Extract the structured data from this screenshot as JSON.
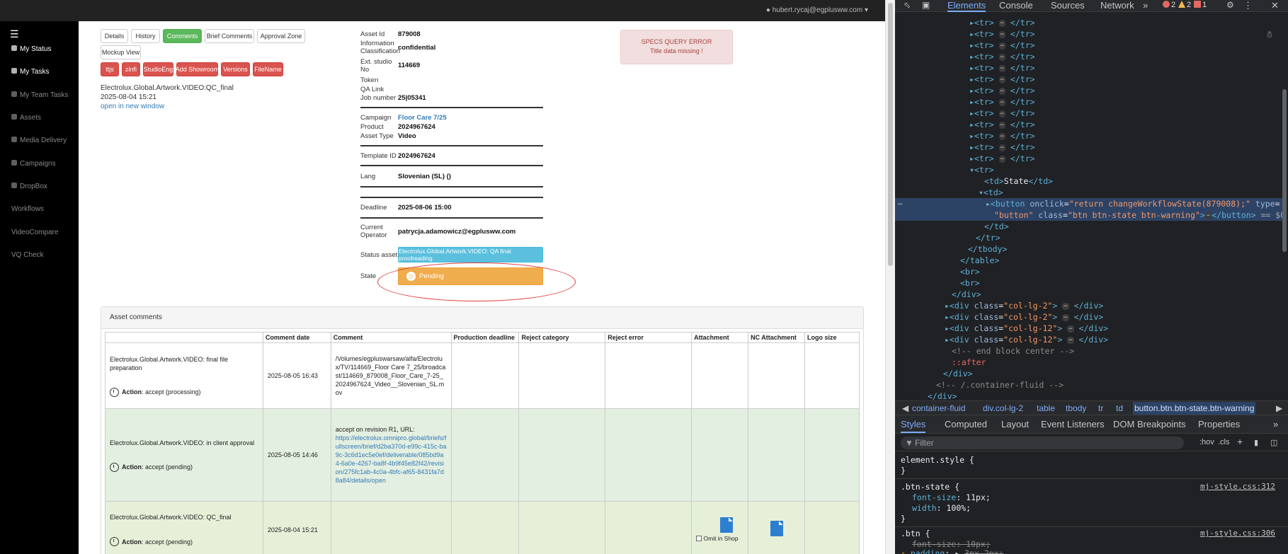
{
  "app": {
    "user": "hubert.rycaj@egplusww.com",
    "sidebar": [
      {
        "label": "My Status",
        "active": true
      },
      {
        "label": "My Tasks",
        "active": true
      },
      {
        "label": "My Team Tasks",
        "active": false
      },
      {
        "label": "Assets",
        "active": false
      },
      {
        "label": "Media Delivery",
        "active": false
      },
      {
        "label": "Campaigns",
        "active": false
      },
      {
        "label": "DropBox",
        "active": false
      },
      {
        "label": "Workflows",
        "active": false
      },
      {
        "label": "VideoCompare",
        "active": false
      },
      {
        "label": "VQ Check",
        "active": false
      }
    ],
    "tabs": [
      "Details",
      "History",
      "Comments",
      "Brief Comments",
      "Approval Zone",
      "Mockup View"
    ],
    "actions": [
      "ttjs",
      "zinfi",
      "StudioEng",
      "Add Showroom",
      "Versions",
      "FileName"
    ],
    "asset_title": "Electrolux.Global.Artwork.VIDEO:QC_final",
    "asset_date": "2025-08-04 15:21",
    "open_new_window": "open in new window",
    "info": {
      "asset_id_label": "Asset Id",
      "asset_id": "879008",
      "info_class_label": "Information Classification",
      "info_class": "confidential",
      "ext_studio_label": "Ext. studio No",
      "ext_studio": "114669",
      "token_label": "Token",
      "qa_link_label": "QA Link",
      "job_label": "Job number",
      "job": "25|05341",
      "campaign_label": "Campaign",
      "campaign": "Floor Care 7/25",
      "product_label": "Product",
      "product": "2024967624",
      "asset_type_label": "Asset Type",
      "asset_type": "Video",
      "template_label": "Template ID",
      "template": "2024967624",
      "lang_label": "Lang",
      "lang": "Slovenian (SL) ()",
      "deadline_label": "Deadline",
      "deadline": "2025-08-06 15:00",
      "operator_label": "Current Operator",
      "operator": "patrycja.adamowicz@egplusww.com",
      "status_label": "Status asset",
      "status": "Electrolux.Global.Artwork.VIDEO: QA final proofreading",
      "state_label": "State",
      "state": "Pending"
    },
    "error": {
      "line1": "SPECS QUERY ERROR",
      "line2": "Title data missing !"
    },
    "comments": {
      "heading": "Asset comments",
      "columns": [
        "",
        "Comment date",
        "Comment",
        "Production deadline",
        "Reject category",
        "Reject error",
        "Attachment",
        "NC Attachment",
        "Logo size"
      ],
      "rows": [
        {
          "workflow": "Electrolux.Global.Artwork.VIDEO: final file preparation",
          "action_label": "Action",
          "action": ": accept (processing)",
          "date": "2025-08-05 16:43",
          "comment": "/Volumes/egpluswarsaw/alfa/Electrolux/TV/114669_Floor Care 7_25/broadcast/114669_879008_Floor_Care_7-25_2024967624_Video__Slovenian_SL.mov",
          "comment_link": ""
        },
        {
          "workflow": "Electrolux.Global.Artwork.VIDEO: in client approval",
          "action_label": "Action",
          "action": ": accept (pending)",
          "date": "2025-08-05 14:46",
          "comment": "accept on revision R1, URL:",
          "comment_link": "https://electrolux.omnipro.global/briefs/fullscreen/brief/d2ba370d-e99c-415c-ba9c-3c6d1ec5e0ef/deliverable/085bd9a4-6a0e-4267-ba8f-4b9f45e82f42/revision/275fc1ab-4c0a-4bfc-af65-8431fa7d8a84/details/open"
        },
        {
          "workflow": "Electrolux.Global.Artwork.VIDEO: QC_final",
          "action_label": "Action",
          "action": ": accept (pending)",
          "date": "2025-08-04 15:21",
          "comment": "",
          "comment_link": "",
          "omit_label": "Omit in Shop"
        }
      ]
    }
  },
  "devtools": {
    "tabs": [
      "Elements",
      "Console",
      "Sources",
      "Network"
    ],
    "errors": "2",
    "warnings": "2",
    "issues": "1",
    "breadcrumb": [
      "container-fluid",
      "div.col-lg-2",
      "table",
      "tbody",
      "tr",
      "td",
      "button.btn.btn-state.btn-warning"
    ],
    "sub_tabs": [
      "Styles",
      "Computed",
      "Layout",
      "Event Listeners",
      "DOM Breakpoints",
      "Properties"
    ],
    "filter_placeholder": "Filter",
    "hov": ":hov",
    "cls": ".cls",
    "td_state": "State",
    "btn_onclick": "return changeWorkflowState(879008);",
    "btn_type": "button",
    "btn_class": "btn btn-state btn-warning",
    "eq": "== $0",
    "col_lg_2": "col-lg-2",
    "col_lg_12": "col-lg-12",
    "end_block": "<!-- end block center -->",
    "after": "::after",
    "container_cmt": "<!-- /.container-fluid -->",
    "rule1_selector": "element.style {",
    "rule2_selector": ".btn-state {",
    "rule2_src": "mj-style.css:312",
    "rule2_p1": "font-size",
    "rule2_v1": "11px;",
    "rule2_p2": "width",
    "rule2_v2": "100%;",
    "rule3_selector": ".btn {",
    "rule3_src": "mj-style.css:306",
    "rule3_p1": "font-size: 10px;",
    "rule3_p2": "padding",
    "rule3_v2": "3px 2px;"
  },
  "colors": {
    "success": "#5cb85c",
    "danger": "#d9534f",
    "info": "#5bc0de",
    "warning": "#f0ad4e",
    "devtools_bg": "#202124"
  }
}
